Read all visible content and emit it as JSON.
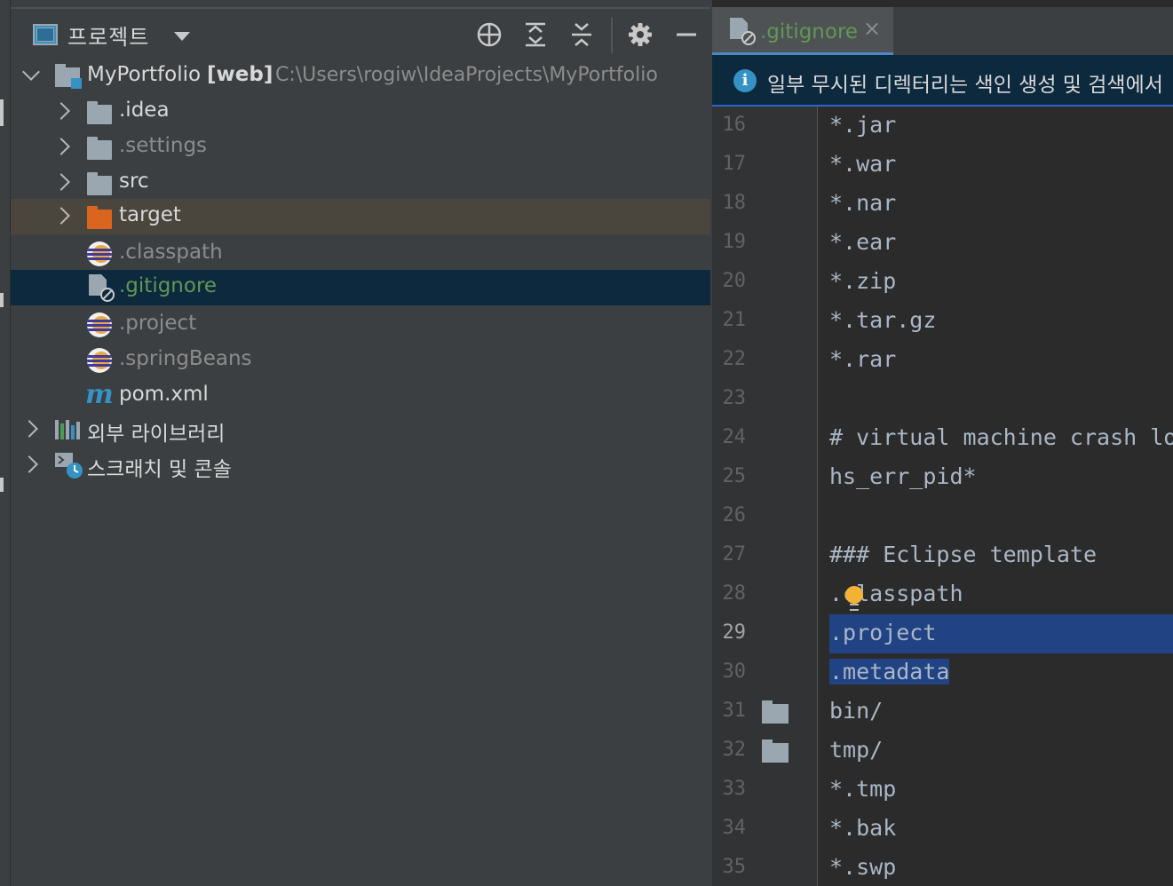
{
  "project_pane": {
    "title": "프로젝트"
  },
  "tree": {
    "root": {
      "name": "MyPortfolio",
      "module": "[web]",
      "path": "C:\\Users\\rogiw\\IdeaProjects\\MyPortfolio"
    },
    "items": [
      {
        "label": ".idea"
      },
      {
        "label": ".settings"
      },
      {
        "label": "src"
      },
      {
        "label": "target"
      },
      {
        "label": ".classpath"
      },
      {
        "label": ".gitignore"
      },
      {
        "label": ".project"
      },
      {
        "label": ".springBeans"
      },
      {
        "label": "pom.xml"
      }
    ],
    "external_libraries": "외부 라이브러리",
    "scratches": "스크래치 및 콘솔"
  },
  "editor": {
    "tab_label": ".gitignore",
    "tab_close": "×",
    "banner_text": "일부 무시된 디렉터리는 색인 생성 및 검색에서",
    "active_line": "29",
    "lines": [
      {
        "n": "16",
        "text": "*.jar"
      },
      {
        "n": "17",
        "text": "*.war"
      },
      {
        "n": "18",
        "text": "*.nar"
      },
      {
        "n": "19",
        "text": "*.ear"
      },
      {
        "n": "20",
        "text": "*.zip"
      },
      {
        "n": "21",
        "text": "*.tar.gz"
      },
      {
        "n": "22",
        "text": "*.rar"
      },
      {
        "n": "23",
        "text": ""
      },
      {
        "n": "24",
        "text": "# virtual machine crash logs"
      },
      {
        "n": "25",
        "text": "hs_err_pid*"
      },
      {
        "n": "26",
        "text": ""
      },
      {
        "n": "27",
        "text": "### Eclipse template"
      },
      {
        "n": "28",
        "text": ".classpath"
      },
      {
        "n": "29",
        "text": ".project"
      },
      {
        "n": "30",
        "text": ".metadata"
      },
      {
        "n": "31",
        "text": "bin/"
      },
      {
        "n": "32",
        "text": "tmp/"
      },
      {
        "n": "33",
        "text": "*.tmp"
      },
      {
        "n": "34",
        "text": "*.bak"
      },
      {
        "n": "35",
        "text": "*.swp"
      }
    ]
  },
  "colors": {
    "background": "#3c3f41",
    "editor_bg": "#2b2b2b",
    "selection": "#214283",
    "tree_selection": "#0d293e",
    "ignored_text": "#8c8c8c",
    "vcs_added": "#629755"
  }
}
